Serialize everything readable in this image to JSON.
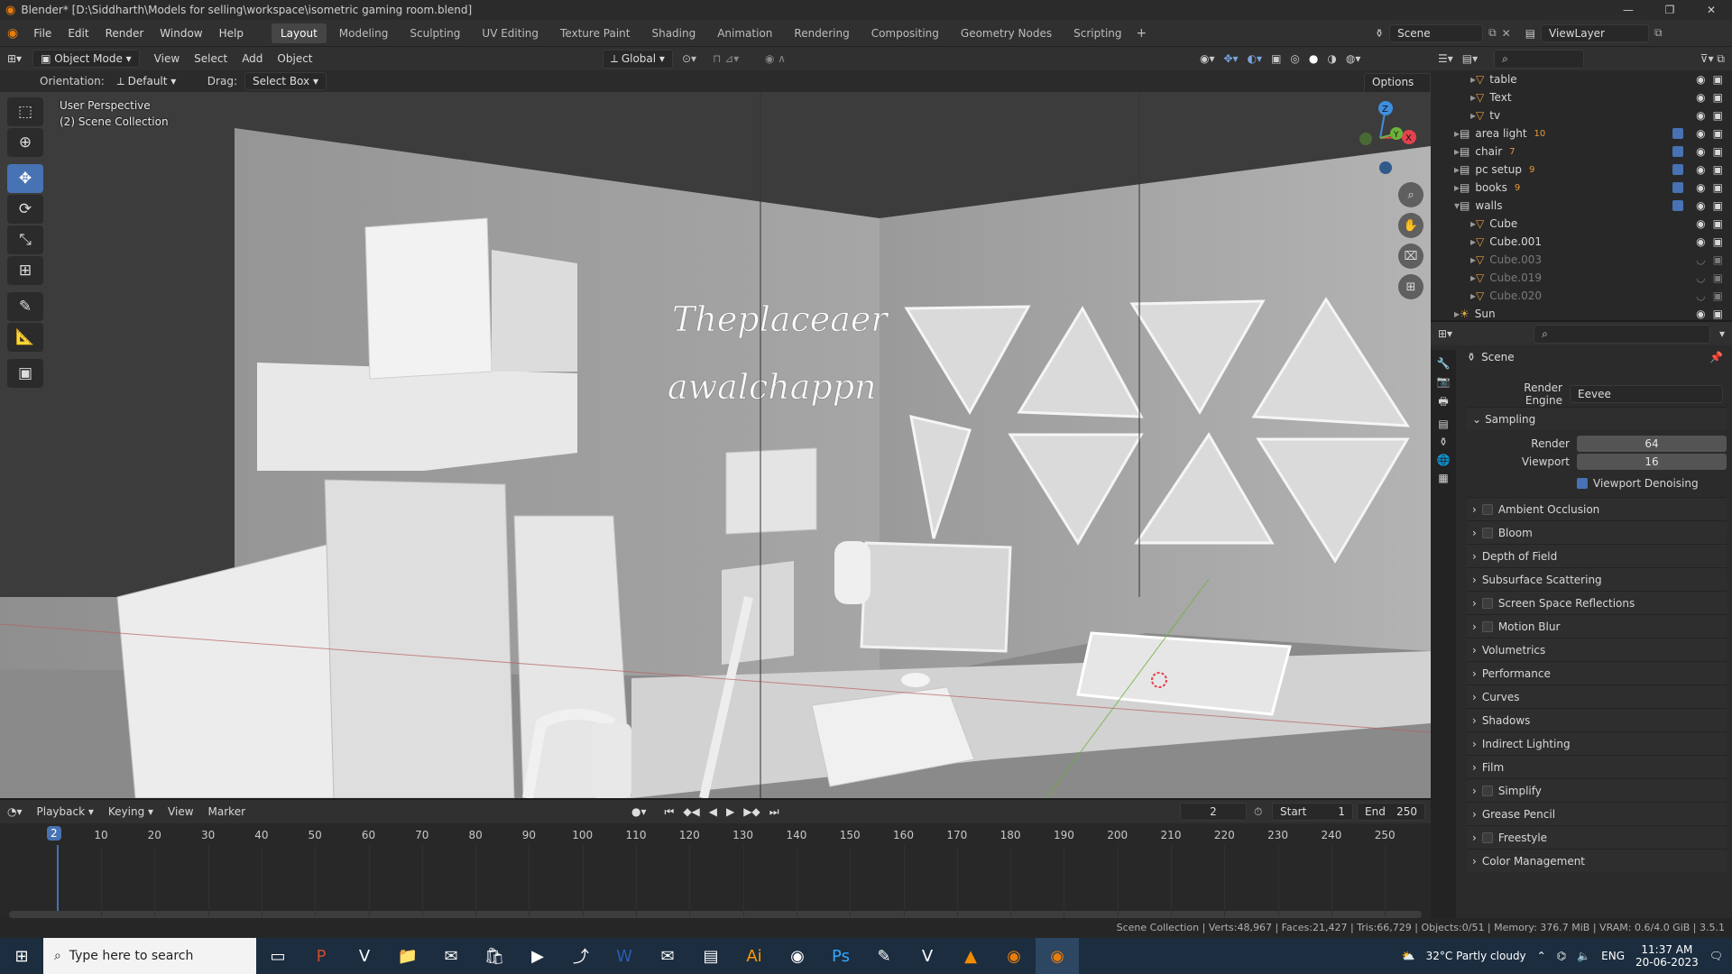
{
  "window": {
    "title": "Blender* [D:\\Siddharth\\Models for selling\\workspace\\isometric gaming room.blend]",
    "controls": [
      "—",
      "❐",
      "✕"
    ]
  },
  "menu": [
    "File",
    "Edit",
    "Render",
    "Window",
    "Help"
  ],
  "workspaces": [
    "Layout",
    "Modeling",
    "Sculpting",
    "UV Editing",
    "Texture Paint",
    "Shading",
    "Animation",
    "Rendering",
    "Compositing",
    "Geometry Nodes",
    "Scripting"
  ],
  "active_workspace": "Layout",
  "scene_name": "Scene",
  "view_layer": "ViewLayer",
  "viewport_header": {
    "mode": "Object Mode",
    "menus": [
      "View",
      "Select",
      "Add",
      "Object"
    ],
    "transform_orientation": "Global",
    "options": "Options"
  },
  "tool_settings": {
    "orientation_label": "Orientation:",
    "orientation_value": "Default",
    "drag_label": "Drag:",
    "drag_value": "Select Box"
  },
  "viewport": {
    "perspective": "User Perspective",
    "collection": "(2) Scene Collection",
    "neon_line1": "Theplaceaer",
    "neon_line2": "awalchappn",
    "gizmo": {
      "z": "Z",
      "x": "X",
      "y": "Y"
    }
  },
  "outliner": [
    {
      "name": "table",
      "level": 2,
      "dim": false
    },
    {
      "name": "Text",
      "level": 2,
      "dim": false
    },
    {
      "name": "tv",
      "level": 2,
      "dim": false
    },
    {
      "name": "area light",
      "level": 1,
      "badge": "10",
      "dim": false
    },
    {
      "name": "chair",
      "level": 1,
      "badge": "7",
      "dim": false
    },
    {
      "name": "pc setup",
      "level": 1,
      "badge": "9",
      "dim": false
    },
    {
      "name": "books",
      "level": 1,
      "badge": "9",
      "dim": false
    },
    {
      "name": "walls",
      "level": 1,
      "dim": false
    },
    {
      "name": "Cube",
      "level": 2,
      "dim": false
    },
    {
      "name": "Cube.001",
      "level": 2,
      "dim": false
    },
    {
      "name": "Cube.003",
      "level": 2,
      "dim": true
    },
    {
      "name": "Cube.019",
      "level": 2,
      "dim": true
    },
    {
      "name": "Cube.020",
      "level": 2,
      "dim": true
    },
    {
      "name": "Sun",
      "level": 1,
      "dim": false
    }
  ],
  "properties": {
    "context": "Scene",
    "render_engine_label": "Render Engine",
    "render_engine": "Eevee",
    "sampling_label": "Sampling",
    "render_label": "Render",
    "render_samples": "64",
    "viewport_label": "Viewport",
    "viewport_samples": "16",
    "viewport_denoising": "Viewport Denoising",
    "panels": [
      {
        "label": "Ambient Occlusion",
        "checkbox": true
      },
      {
        "label": "Bloom",
        "checkbox": true
      },
      {
        "label": "Depth of Field",
        "checkbox": false
      },
      {
        "label": "Subsurface Scattering",
        "checkbox": false
      },
      {
        "label": "Screen Space Reflections",
        "checkbox": true
      },
      {
        "label": "Motion Blur",
        "checkbox": true
      },
      {
        "label": "Volumetrics",
        "checkbox": false
      },
      {
        "label": "Performance",
        "checkbox": false
      },
      {
        "label": "Curves",
        "checkbox": false
      },
      {
        "label": "Shadows",
        "checkbox": false
      },
      {
        "label": "Indirect Lighting",
        "checkbox": false
      },
      {
        "label": "Film",
        "checkbox": false
      },
      {
        "label": "Simplify",
        "checkbox": true
      },
      {
        "label": "Grease Pencil",
        "checkbox": false
      },
      {
        "label": "Freestyle",
        "checkbox": true
      },
      {
        "label": "Color Management",
        "checkbox": false
      }
    ]
  },
  "timeline": {
    "menus": [
      "Playback",
      "Keying",
      "View",
      "Marker"
    ],
    "current_frame": "2",
    "start_label": "Start",
    "start": "1",
    "end_label": "End",
    "end": "250",
    "ticks": [
      "10",
      "20",
      "30",
      "40",
      "50",
      "60",
      "70",
      "80",
      "90",
      "100",
      "110",
      "120",
      "130",
      "140",
      "150",
      "160",
      "170",
      "180",
      "190",
      "200",
      "210",
      "220",
      "230",
      "240",
      "250"
    ]
  },
  "status_bar": "Scene Collection | Verts:48,967 | Faces:21,427 | Tris:66,729 | Objects:0/51 | Memory: 376.7 MiB | VRAM: 0.6/4.0 GiB | 3.5.1",
  "taskbar": {
    "search_placeholder": "Type here to search",
    "weather": "32°C  Partly cloudy",
    "language": "ENG",
    "time": "11:37 AM",
    "date": "20-06-2023",
    "apps": [
      "task-view",
      "powerpoint",
      "vectornator",
      "file-explorer",
      "mail",
      "store",
      "video-editor",
      "remote-desktop",
      "word",
      "mail-client",
      "archive",
      "illustrator",
      "chrome",
      "photoshop",
      "paint",
      "vectornator-2",
      "vlc",
      "blender",
      "blender-active"
    ]
  },
  "colors": {
    "accent": "#4772b3",
    "blender_orange": "#e87d0d",
    "x_axis": "#e4424d",
    "y_axis": "#6cb23a",
    "z_axis": "#3f8fe0"
  }
}
